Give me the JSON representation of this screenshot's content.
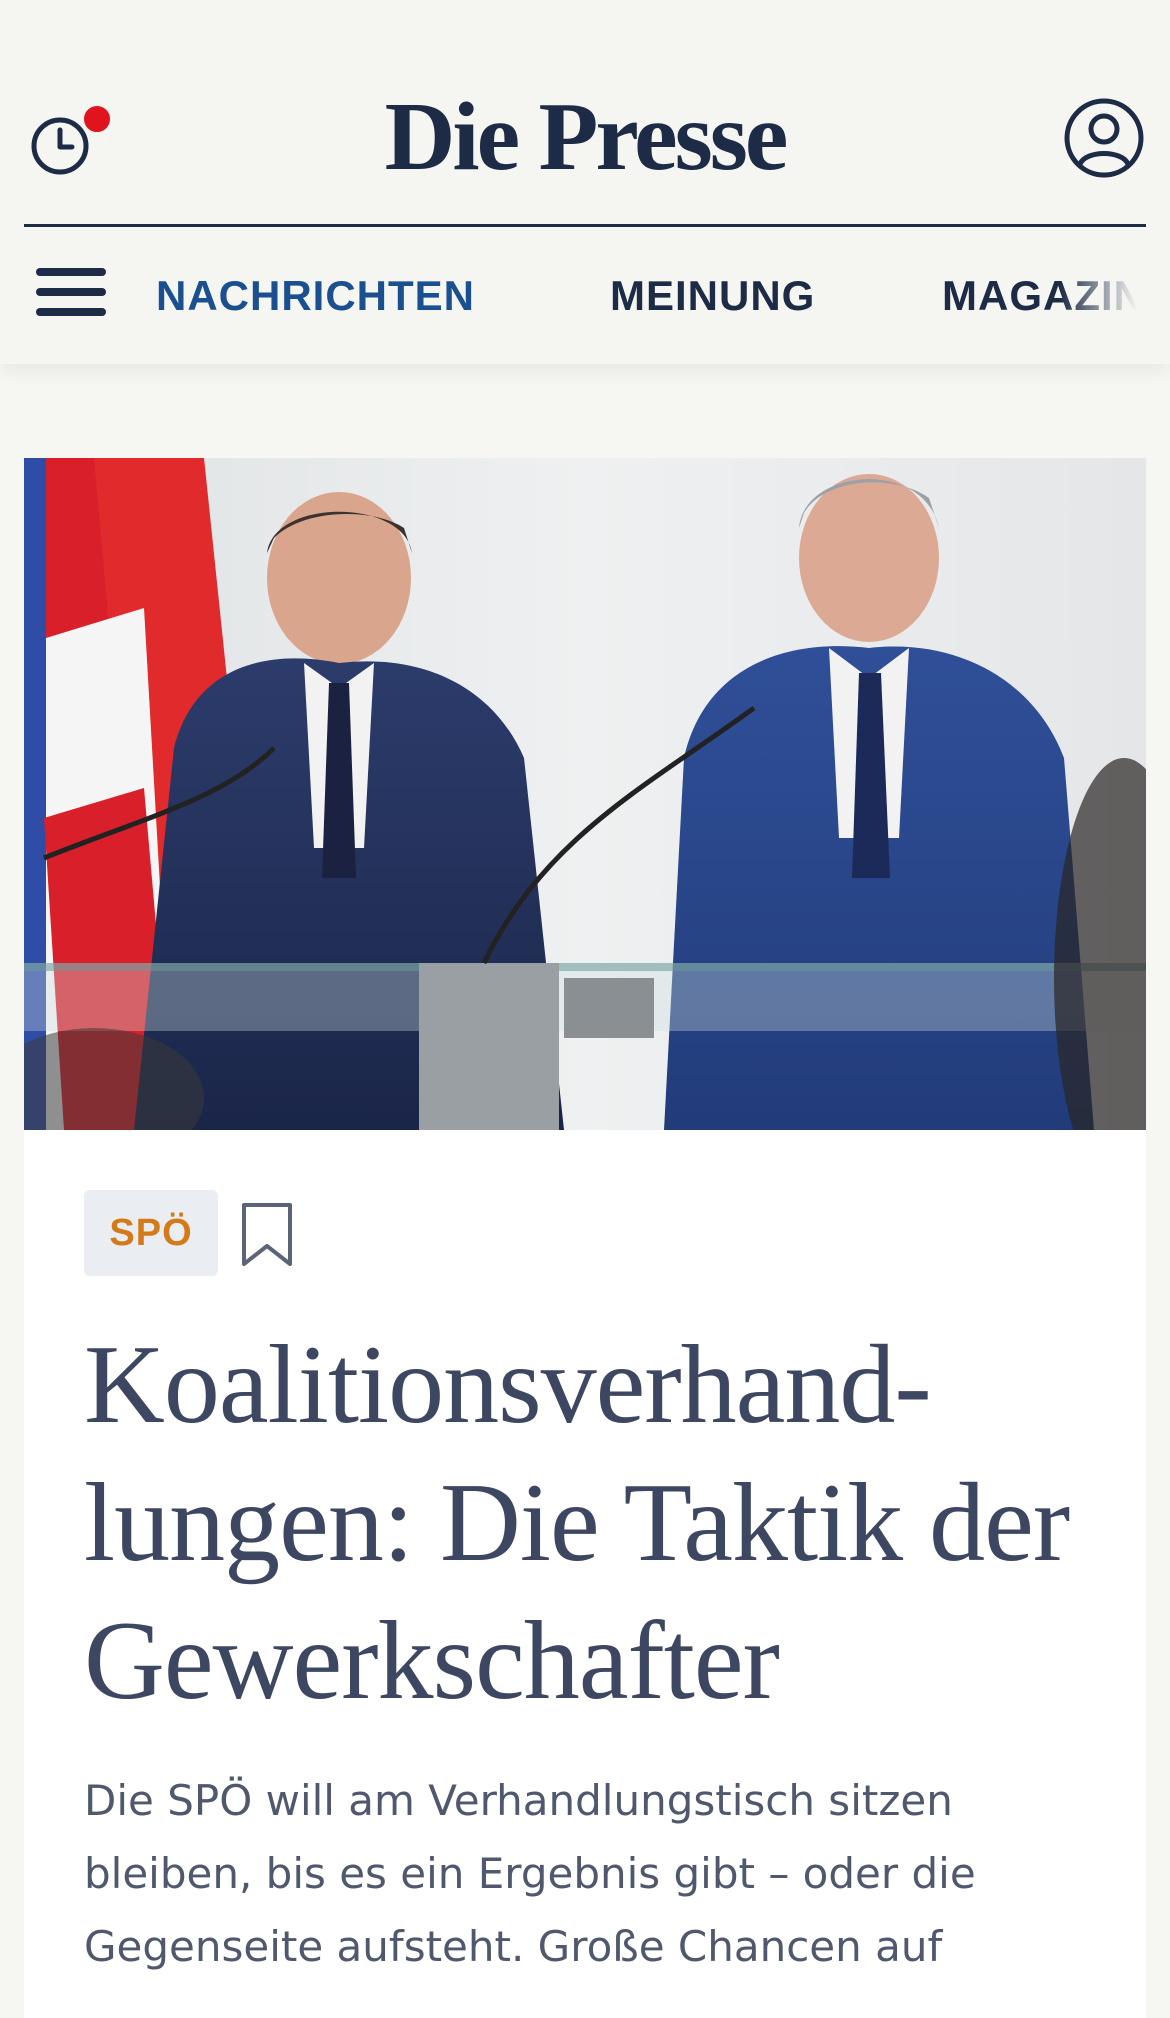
{
  "header": {
    "logo": "Die Presse",
    "has_notification": true,
    "nav": {
      "items": [
        {
          "label": "NACHRICHTEN",
          "active": true
        },
        {
          "label": "MEINUNG",
          "active": false
        },
        {
          "label": "MAGAZIN",
          "active": false
        }
      ]
    }
  },
  "article": {
    "tag": "SPÖ",
    "headline": "Koalitionsverhand­lungen: Die Taktik der Gewerkschafter",
    "lead": "Die SPÖ will am Verhandlungstisch sitzen bleiben, bis es ein Ergebnis gibt – oder die Gegenseite aufsteht. Große Chancen auf"
  },
  "colors": {
    "brand_navy": "#1d2b47",
    "nav_active": "#1b5090",
    "tag_text": "#d47a18",
    "tag_bg": "#eaeef2",
    "notification": "#e1141e",
    "page_bg": "#f5f5f1"
  },
  "icons": {
    "history": "clock-history-icon",
    "account": "user-circle-icon",
    "menu": "hamburger-menu-icon",
    "bookmark": "bookmark-icon"
  }
}
